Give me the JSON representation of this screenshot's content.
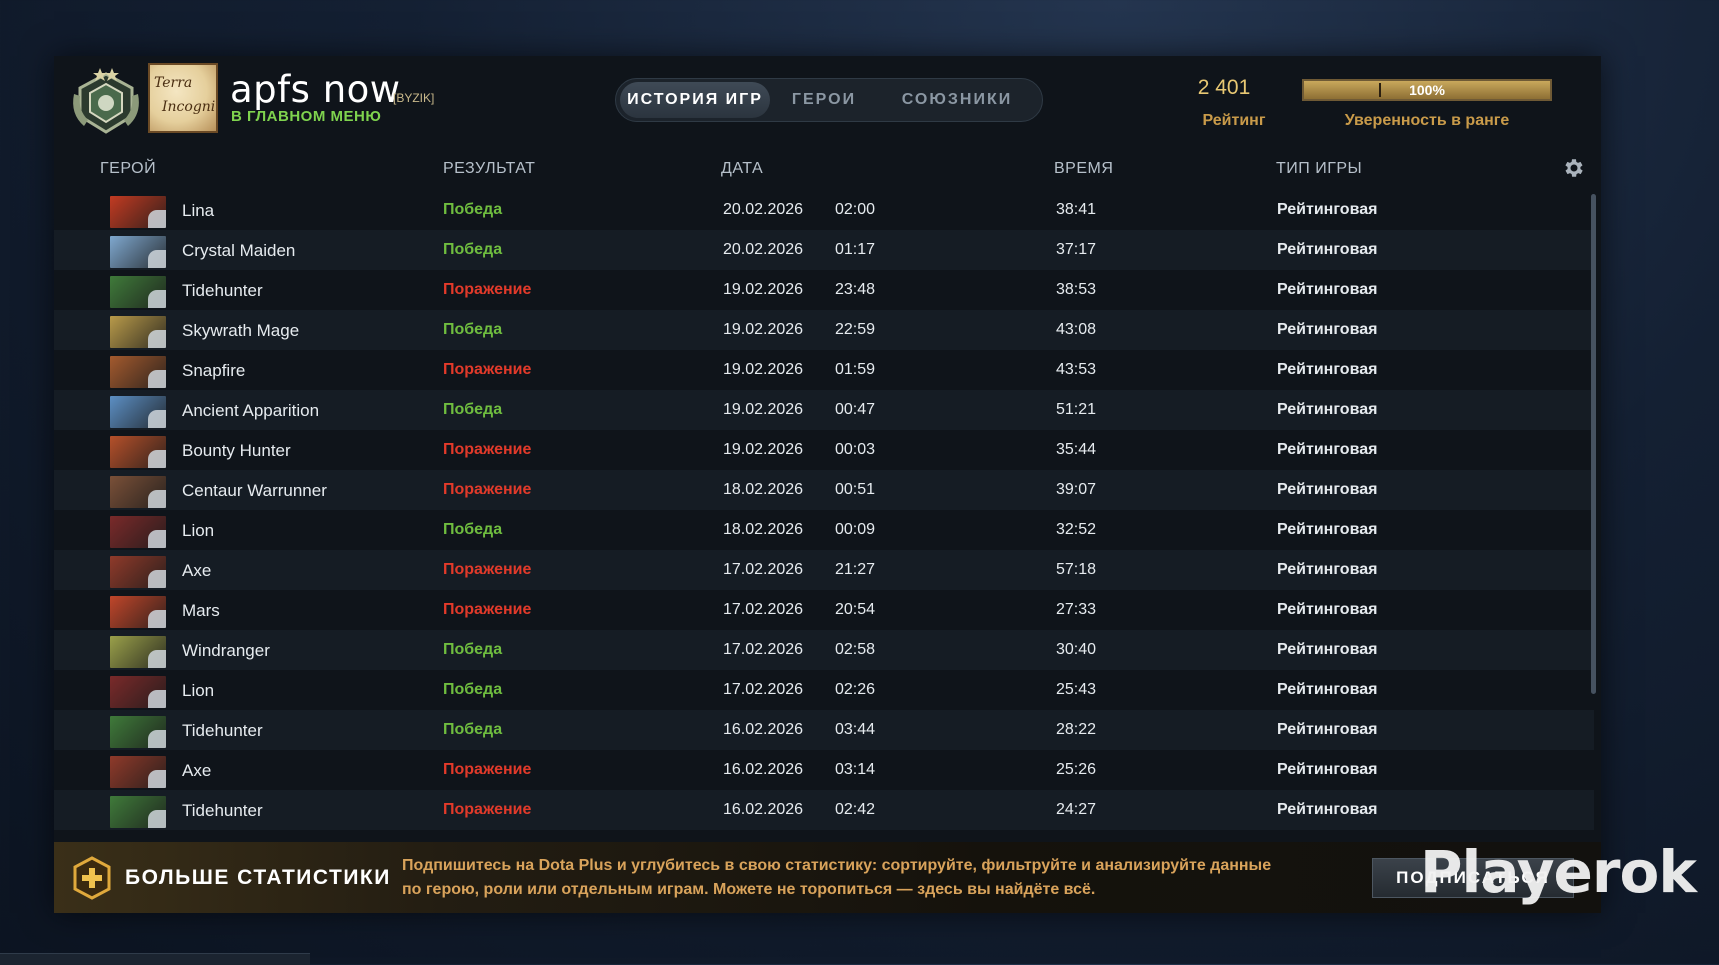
{
  "player": {
    "name": "apfs now",
    "tag": "[BYZIK]",
    "status": "В ГЛАВНОМ МЕНЮ",
    "avatar_text_1": "Terra",
    "avatar_text_2": "Incognita"
  },
  "tabs": [
    {
      "label": "ИСТОРИЯ ИГР",
      "active": true
    },
    {
      "label": "ГЕРОИ",
      "active": false
    },
    {
      "label": "СОЮЗНИКИ",
      "active": false
    }
  ],
  "rating": {
    "value": "2 401",
    "label": "Рейтинг",
    "confidence_text": "100%",
    "confidence_fraction": 1.0,
    "confidence_label": "Уверенность в ранге"
  },
  "columns": {
    "hero": "ГЕРОЙ",
    "result": "РЕЗУЛЬТАТ",
    "date": "ДАТА",
    "time": "ВРЕМЯ",
    "type": "ТИП ИГРЫ"
  },
  "matches": [
    {
      "hero": "Lina",
      "result": "Победа",
      "win": true,
      "date": "20.02.2026",
      "clock": "02:00",
      "duration": "38:41",
      "type": "Рейтинговая",
      "color": "#c23b22"
    },
    {
      "hero": "Crystal Maiden",
      "result": "Победа",
      "win": true,
      "date": "20.02.2026",
      "clock": "01:17",
      "duration": "37:17",
      "type": "Рейтинговая",
      "color": "#7fa8cf"
    },
    {
      "hero": "Tidehunter",
      "result": "Поражение",
      "win": false,
      "date": "19.02.2026",
      "clock": "23:48",
      "duration": "38:53",
      "type": "Рейтинговая",
      "color": "#3f7a3a"
    },
    {
      "hero": "Skywrath Mage",
      "result": "Победа",
      "win": true,
      "date": "19.02.2026",
      "clock": "22:59",
      "duration": "43:08",
      "type": "Рейтинговая",
      "color": "#b89a4a"
    },
    {
      "hero": "Snapfire",
      "result": "Поражение",
      "win": false,
      "date": "19.02.2026",
      "clock": "01:59",
      "duration": "43:53",
      "type": "Рейтинговая",
      "color": "#a35a2e"
    },
    {
      "hero": "Ancient Apparition",
      "result": "Победа",
      "win": true,
      "date": "19.02.2026",
      "clock": "00:47",
      "duration": "51:21",
      "type": "Рейтинговая",
      "color": "#5c8fc4"
    },
    {
      "hero": "Bounty Hunter",
      "result": "Поражение",
      "win": false,
      "date": "19.02.2026",
      "clock": "00:03",
      "duration": "35:44",
      "type": "Рейтинговая",
      "color": "#b5502a"
    },
    {
      "hero": "Centaur Warrunner",
      "result": "Поражение",
      "win": false,
      "date": "18.02.2026",
      "clock": "00:51",
      "duration": "39:07",
      "type": "Рейтинговая",
      "color": "#7a5038"
    },
    {
      "hero": "Lion",
      "result": "Победа",
      "win": true,
      "date": "18.02.2026",
      "clock": "00:09",
      "duration": "32:52",
      "type": "Рейтинговая",
      "color": "#7a2a2a"
    },
    {
      "hero": "Axe",
      "result": "Поражение",
      "win": false,
      "date": "17.02.2026",
      "clock": "21:27",
      "duration": "57:18",
      "type": "Рейтинговая",
      "color": "#8f3a2a"
    },
    {
      "hero": "Mars",
      "result": "Поражение",
      "win": false,
      "date": "17.02.2026",
      "clock": "20:54",
      "duration": "27:33",
      "type": "Рейтинговая",
      "color": "#c0462a"
    },
    {
      "hero": "Windranger",
      "result": "Победа",
      "win": true,
      "date": "17.02.2026",
      "clock": "02:58",
      "duration": "30:40",
      "type": "Рейтинговая",
      "color": "#9aa04a"
    },
    {
      "hero": "Lion",
      "result": "Победа",
      "win": true,
      "date": "17.02.2026",
      "clock": "02:26",
      "duration": "25:43",
      "type": "Рейтинговая",
      "color": "#7a2a2a"
    },
    {
      "hero": "Tidehunter",
      "result": "Победа",
      "win": true,
      "date": "16.02.2026",
      "clock": "03:44",
      "duration": "28:22",
      "type": "Рейтинговая",
      "color": "#3f7a3a"
    },
    {
      "hero": "Axe",
      "result": "Поражение",
      "win": false,
      "date": "16.02.2026",
      "clock": "03:14",
      "duration": "25:26",
      "type": "Рейтинговая",
      "color": "#8f3a2a"
    },
    {
      "hero": "Tidehunter",
      "result": "Поражение",
      "win": false,
      "date": "16.02.2026",
      "clock": "02:42",
      "duration": "24:27",
      "type": "Рейтинговая",
      "color": "#3f7a3a"
    }
  ],
  "banner": {
    "title": "БОЛЬШЕ СТАТИСТИКИ",
    "text": "Подпишитесь на Dota Plus и углубитесь в свою статистику: сортируйте, фильтруйте и анализируйте данные по герою, роли или отдельным играм. Можете не торопиться — здесь вы найдёте всё.",
    "button": "ПОДПИСАТЬСЯ"
  },
  "watermark": "Playerok",
  "icons": {
    "rank": "rank-medal-icon",
    "settings": "gear-icon",
    "plus": "dota-plus-icon"
  }
}
